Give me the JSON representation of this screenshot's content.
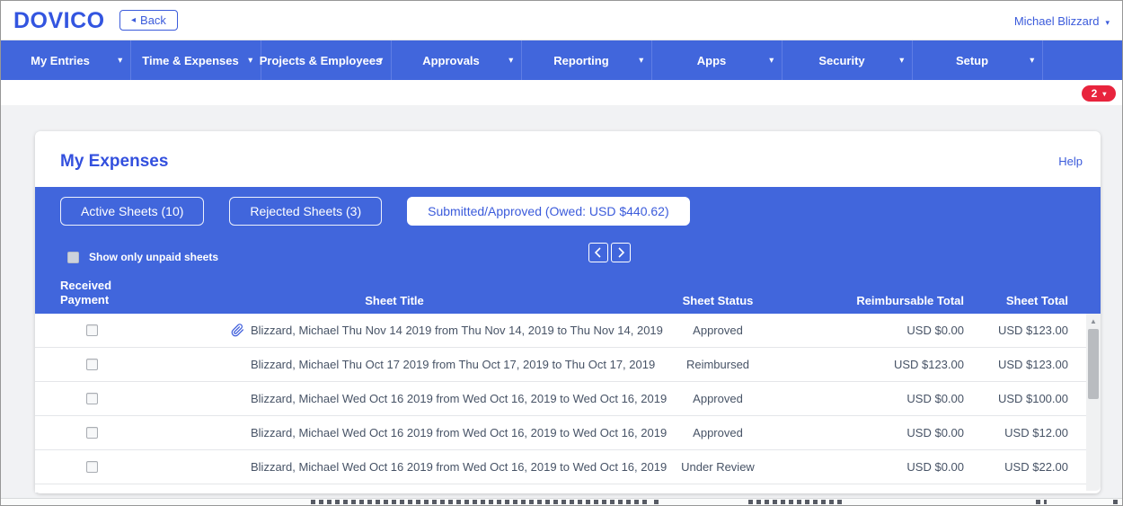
{
  "header": {
    "logo": "DOVICO",
    "back_label": "Back",
    "user_name": "Michael Blizzard"
  },
  "nav": {
    "items": [
      {
        "label": "My Entries"
      },
      {
        "label": "Time & Expenses"
      },
      {
        "label": "Projects & Employees"
      },
      {
        "label": "Approvals"
      },
      {
        "label": "Reporting"
      },
      {
        "label": "Apps"
      },
      {
        "label": "Security"
      },
      {
        "label": "Setup"
      }
    ]
  },
  "notification": {
    "count": "2"
  },
  "page": {
    "title": "My Expenses",
    "help_label": "Help"
  },
  "tabs": [
    {
      "label": "Active Sheets (10)",
      "active": false
    },
    {
      "label": "Rejected Sheets (3)",
      "active": false
    },
    {
      "label": "Submitted/Approved (Owed: USD $440.62)",
      "active": true
    }
  ],
  "filters": {
    "show_only_unpaid_label": "Show only unpaid sheets",
    "checked": false
  },
  "table": {
    "columns": [
      "Received Payment",
      "Sheet Title",
      "Sheet Status",
      "Reimbursable Total",
      "Sheet Total"
    ],
    "rows": [
      {
        "checked": false,
        "has_attachment": true,
        "title": "Blizzard, Michael Thu Nov 14 2019 from Thu Nov 14, 2019 to Thu Nov 14, 2019",
        "status": "Approved",
        "reimbursable": "USD $0.00",
        "total": "USD $123.00"
      },
      {
        "checked": false,
        "has_attachment": false,
        "title": "Blizzard, Michael Thu Oct 17 2019 from Thu Oct 17, 2019 to Thu Oct 17, 2019",
        "status": "Reimbursed",
        "reimbursable": "USD $123.00",
        "total": "USD $123.00"
      },
      {
        "checked": false,
        "has_attachment": false,
        "title": "Blizzard, Michael Wed Oct 16 2019 from Wed Oct 16, 2019 to Wed Oct 16, 2019",
        "status": "Approved",
        "reimbursable": "USD $0.00",
        "total": "USD $100.00"
      },
      {
        "checked": false,
        "has_attachment": false,
        "title": "Blizzard, Michael Wed Oct 16 2019 from Wed Oct 16, 2019 to Wed Oct 16, 2019",
        "status": "Approved",
        "reimbursable": "USD $0.00",
        "total": "USD $12.00"
      },
      {
        "checked": false,
        "has_attachment": false,
        "title": "Blizzard, Michael Wed Oct 16 2019 from Wed Oct 16, 2019 to Wed Oct 16, 2019",
        "status": "Under Review",
        "reimbursable": "USD $0.00",
        "total": "USD $22.00"
      }
    ]
  },
  "icons": {
    "chevron_down": "▾",
    "back_arrow": "◂",
    "scroll_up": "▲"
  },
  "colors": {
    "nav_blue": "#4166dc",
    "accent_blue": "#3b5bdb",
    "badge_red": "#e8243d"
  }
}
